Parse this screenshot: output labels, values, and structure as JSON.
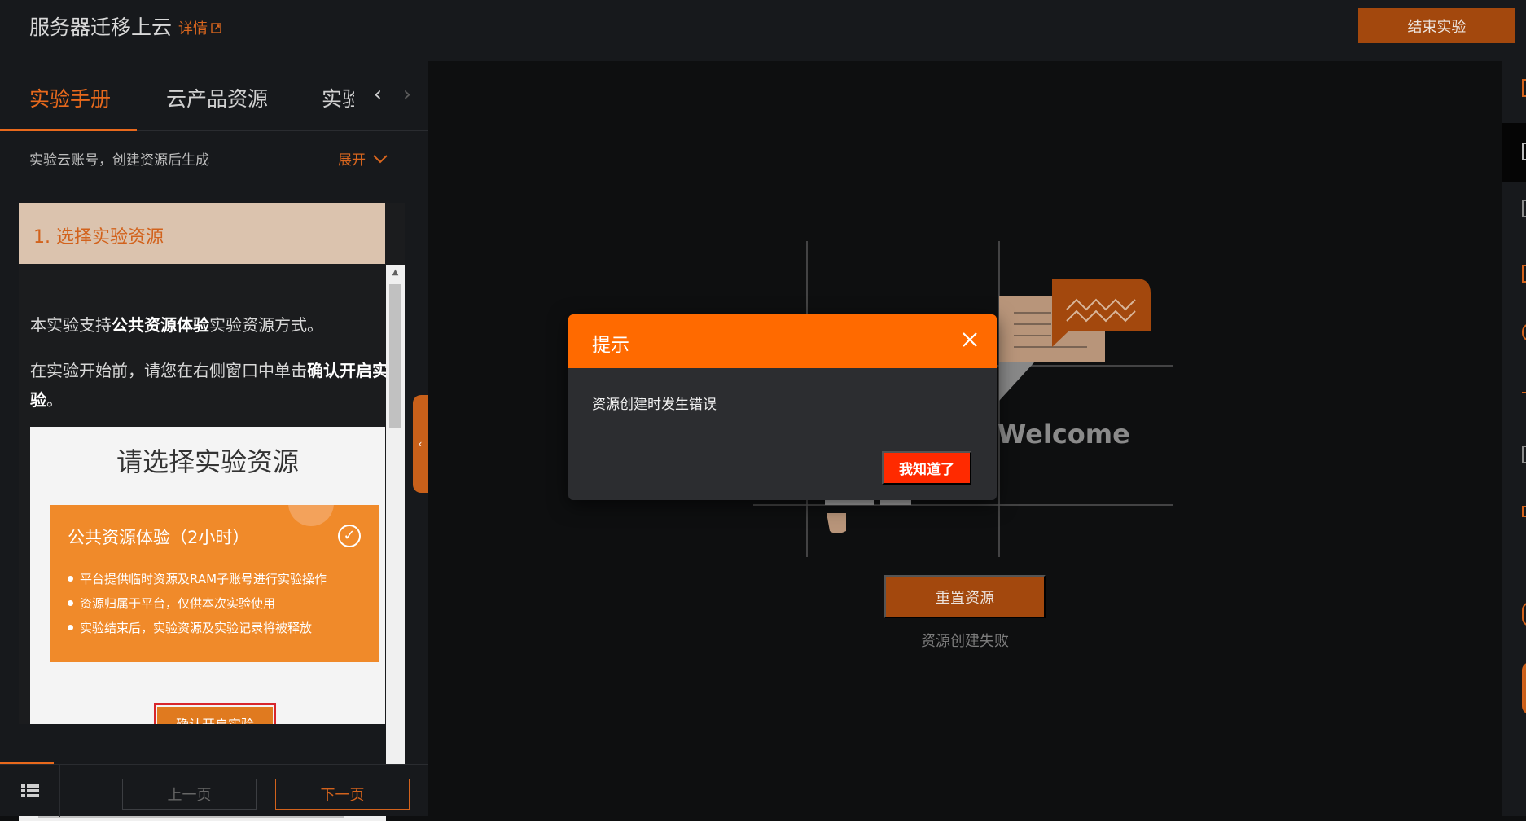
{
  "header": {
    "title": "服务器迁移上云",
    "details_label": "详情",
    "end_button": "结束实验"
  },
  "tabs": [
    {
      "label": "实验手册",
      "active": true
    },
    {
      "label": "云产品资源",
      "active": false
    },
    {
      "label": "实验",
      "active": false
    }
  ],
  "account": {
    "info": "实验云账号，创建资源后生成",
    "expand_label": "展开"
  },
  "doc": {
    "section_title": "1. 选择实验资源",
    "p1_pre": "本实验支持",
    "p1_bold": "公共资源体验",
    "p1_post": "实验资源方式。",
    "p2_pre": "在实验开始前，请您在右侧窗口中单击",
    "p2_bold": "确认开启实验",
    "p2_post": "。",
    "image": {
      "title": "请选择实验资源",
      "card_title": "公共资源体验（2小时）",
      "bullets": [
        "平台提供临时资源及RAM子账号进行实验操作",
        "资源归属于平台，仅供本次实验使用",
        "实验结束后，实验资源及实验记录将被释放"
      ],
      "confirm_button": "确认开启实验"
    }
  },
  "footer": {
    "prev": "上一页",
    "next": "下一页"
  },
  "main": {
    "welcome": "Welcome",
    "reset_button": "重置资源",
    "status": "资源创建失败"
  },
  "modal": {
    "title": "提示",
    "message": "资源创建时发生错误",
    "ok_button": "我知道了"
  },
  "colors": {
    "accent": "#e8691c",
    "modal_header": "#ff6a00",
    "modal_ok": "#ff2a00",
    "dark_button": "#a3480d"
  }
}
